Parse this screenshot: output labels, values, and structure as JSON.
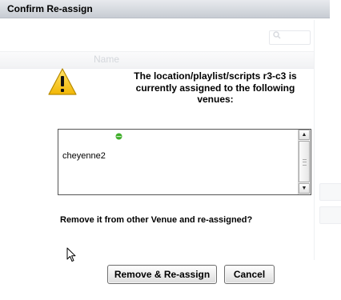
{
  "dialog": {
    "title": "Confirm Re-assign",
    "message": "The location/playlist/scripts r3-c3 is\ncurrently assigned to the following\nvenues:",
    "venues": [
      "cheyenne2"
    ],
    "question": "Remove it from other Venue and re-assigned?",
    "buttons": {
      "remove_reassign": "Remove & Re-assign",
      "cancel": "Cancel"
    }
  },
  "background": {
    "column_header": "Name"
  },
  "icons": {
    "warning": "warning-icon",
    "status": "green-status-dot-icon",
    "search": "search-icon",
    "cursor": "mouse-pointer-icon"
  },
  "colors": {
    "warning_fill": "#f6c21c",
    "status_green": "#3fae2a",
    "titlebar": "#d3d7dd"
  }
}
